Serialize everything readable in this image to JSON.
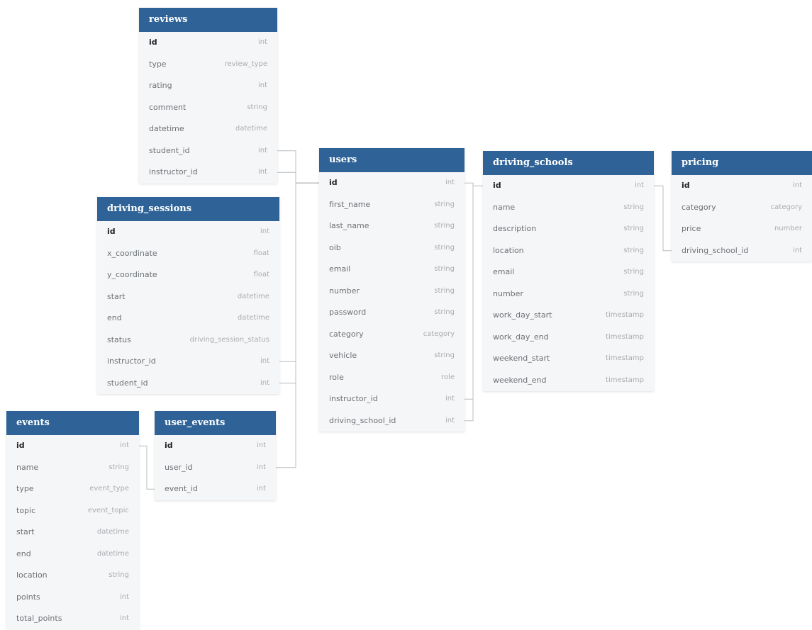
{
  "diagram": {
    "tables": [
      {
        "key": "reviews",
        "name": "reviews",
        "fields": [
          {
            "name": "id",
            "type": "int",
            "pk": true
          },
          {
            "name": "type",
            "type": "review_type"
          },
          {
            "name": "rating",
            "type": "int"
          },
          {
            "name": "comment",
            "type": "string"
          },
          {
            "name": "datetime",
            "type": "datetime"
          },
          {
            "name": "student_id",
            "type": "int"
          },
          {
            "name": "instructor_id",
            "type": "int"
          }
        ]
      },
      {
        "key": "driving_sessions",
        "name": "driving_sessions",
        "fields": [
          {
            "name": "id",
            "type": "int",
            "pk": true
          },
          {
            "name": "x_coordinate",
            "type": "float"
          },
          {
            "name": "y_coordinate",
            "type": "float"
          },
          {
            "name": "start",
            "type": "datetime"
          },
          {
            "name": "end",
            "type": "datetime"
          },
          {
            "name": "status",
            "type": "driving_session_status"
          },
          {
            "name": "instructor_id",
            "type": "int"
          },
          {
            "name": "student_id",
            "type": "int"
          }
        ]
      },
      {
        "key": "events",
        "name": "events",
        "fields": [
          {
            "name": "id",
            "type": "int",
            "pk": true
          },
          {
            "name": "name",
            "type": "string"
          },
          {
            "name": "type",
            "type": "event_type"
          },
          {
            "name": "topic",
            "type": "event_topic"
          },
          {
            "name": "start",
            "type": "datetime"
          },
          {
            "name": "end",
            "type": "datetime"
          },
          {
            "name": "location",
            "type": "string"
          },
          {
            "name": "points",
            "type": "int"
          },
          {
            "name": "total_points",
            "type": "int"
          }
        ]
      },
      {
        "key": "user_events",
        "name": "user_events",
        "fields": [
          {
            "name": "id",
            "type": "int",
            "pk": true
          },
          {
            "name": "user_id",
            "type": "int"
          },
          {
            "name": "event_id",
            "type": "int"
          }
        ]
      },
      {
        "key": "users",
        "name": "users",
        "fields": [
          {
            "name": "id",
            "type": "int",
            "pk": true
          },
          {
            "name": "first_name",
            "type": "string"
          },
          {
            "name": "last_name",
            "type": "string"
          },
          {
            "name": "oib",
            "type": "string"
          },
          {
            "name": "email",
            "type": "string"
          },
          {
            "name": "number",
            "type": "string"
          },
          {
            "name": "password",
            "type": "string"
          },
          {
            "name": "category",
            "type": "category"
          },
          {
            "name": "vehicle",
            "type": "string"
          },
          {
            "name": "role",
            "type": "role"
          },
          {
            "name": "instructor_id",
            "type": "int"
          },
          {
            "name": "driving_school_id",
            "type": "int"
          }
        ]
      },
      {
        "key": "driving_schools",
        "name": "driving_schools",
        "fields": [
          {
            "name": "id",
            "type": "int",
            "pk": true
          },
          {
            "name": "name",
            "type": "string"
          },
          {
            "name": "description",
            "type": "string"
          },
          {
            "name": "location",
            "type": "string"
          },
          {
            "name": "email",
            "type": "string"
          },
          {
            "name": "number",
            "type": "string"
          },
          {
            "name": "work_day_start",
            "type": "timestamp"
          },
          {
            "name": "work_day_end",
            "type": "timestamp"
          },
          {
            "name": "weekend_start",
            "type": "timestamp"
          },
          {
            "name": "weekend_end",
            "type": "timestamp"
          }
        ]
      },
      {
        "key": "pricing",
        "name": "pricing",
        "fields": [
          {
            "name": "id",
            "type": "int",
            "pk": true
          },
          {
            "name": "category",
            "type": "category"
          },
          {
            "name": "price",
            "type": "number"
          },
          {
            "name": "driving_school_id",
            "type": "int"
          }
        ]
      }
    ],
    "relations": [
      {
        "from": "reviews.student_id",
        "to": "users.id"
      },
      {
        "from": "reviews.instructor_id",
        "to": "users.id"
      },
      {
        "from": "driving_sessions.instructor_id",
        "to": "users.id"
      },
      {
        "from": "driving_sessions.student_id",
        "to": "users.id"
      },
      {
        "from": "user_events.user_id",
        "to": "users.id"
      },
      {
        "from": "user_events.event_id",
        "to": "events.id"
      },
      {
        "from": "users.instructor_id",
        "to": "users.id"
      },
      {
        "from": "users.driving_school_id",
        "to": "driving_schools.id"
      },
      {
        "from": "pricing.driving_school_id",
        "to": "driving_schools.id"
      }
    ],
    "colors": {
      "header": "#2f6397",
      "header_text": "#ffffff",
      "table_bg": "#f5f6f7",
      "connector": "#b9bcbf",
      "pk_text": "#1f2328",
      "field_text": "#6d7176",
      "type_text": "#a9adb1"
    }
  }
}
